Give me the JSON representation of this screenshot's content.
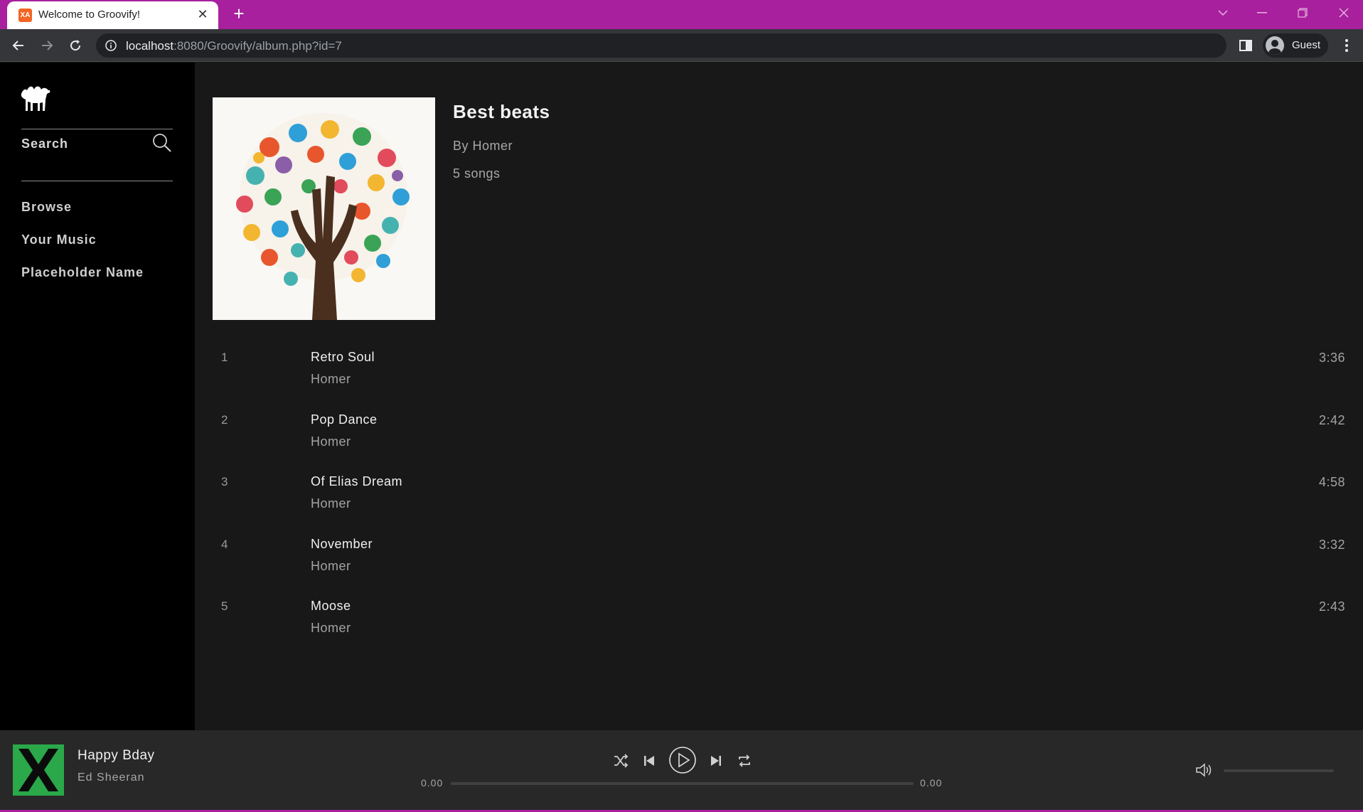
{
  "browser": {
    "tab_title": "Welcome to Groovify!",
    "favicon_text": "XA",
    "url_host": "localhost",
    "url_path": ":8080/Groovify/album.php?id=7",
    "profile_label": "Guest",
    "frame_color": "#a8209d"
  },
  "sidebar": {
    "search_label": "Search",
    "items": [
      {
        "label": "Browse"
      },
      {
        "label": "Your Music"
      },
      {
        "label": "Placeholder Name"
      }
    ]
  },
  "album": {
    "title": "Best beats",
    "artist_line": "By Homer",
    "song_count": "5 songs"
  },
  "tracks": [
    {
      "num": "1",
      "name": "Retro Soul",
      "artist": "Homer",
      "duration": "3:36"
    },
    {
      "num": "2",
      "name": "Pop Dance",
      "artist": "Homer",
      "duration": "2:42"
    },
    {
      "num": "3",
      "name": "Of Elias Dream",
      "artist": "Homer",
      "duration": "4:58"
    },
    {
      "num": "4",
      "name": "November",
      "artist": "Homer",
      "duration": "3:32"
    },
    {
      "num": "5",
      "name": "Moose",
      "artist": "Homer",
      "duration": "2:43"
    }
  ],
  "player": {
    "title": "Happy Bday",
    "artist": "Ed Sheeran",
    "time_current": "0.00",
    "time_total": "0.00",
    "progress": 0,
    "volume": 0
  },
  "icons": {
    "shuffle": "shuffle-icon",
    "previous": "previous-icon",
    "play": "play-icon",
    "next": "next-icon",
    "repeat": "repeat-icon",
    "volume": "volume-icon"
  }
}
